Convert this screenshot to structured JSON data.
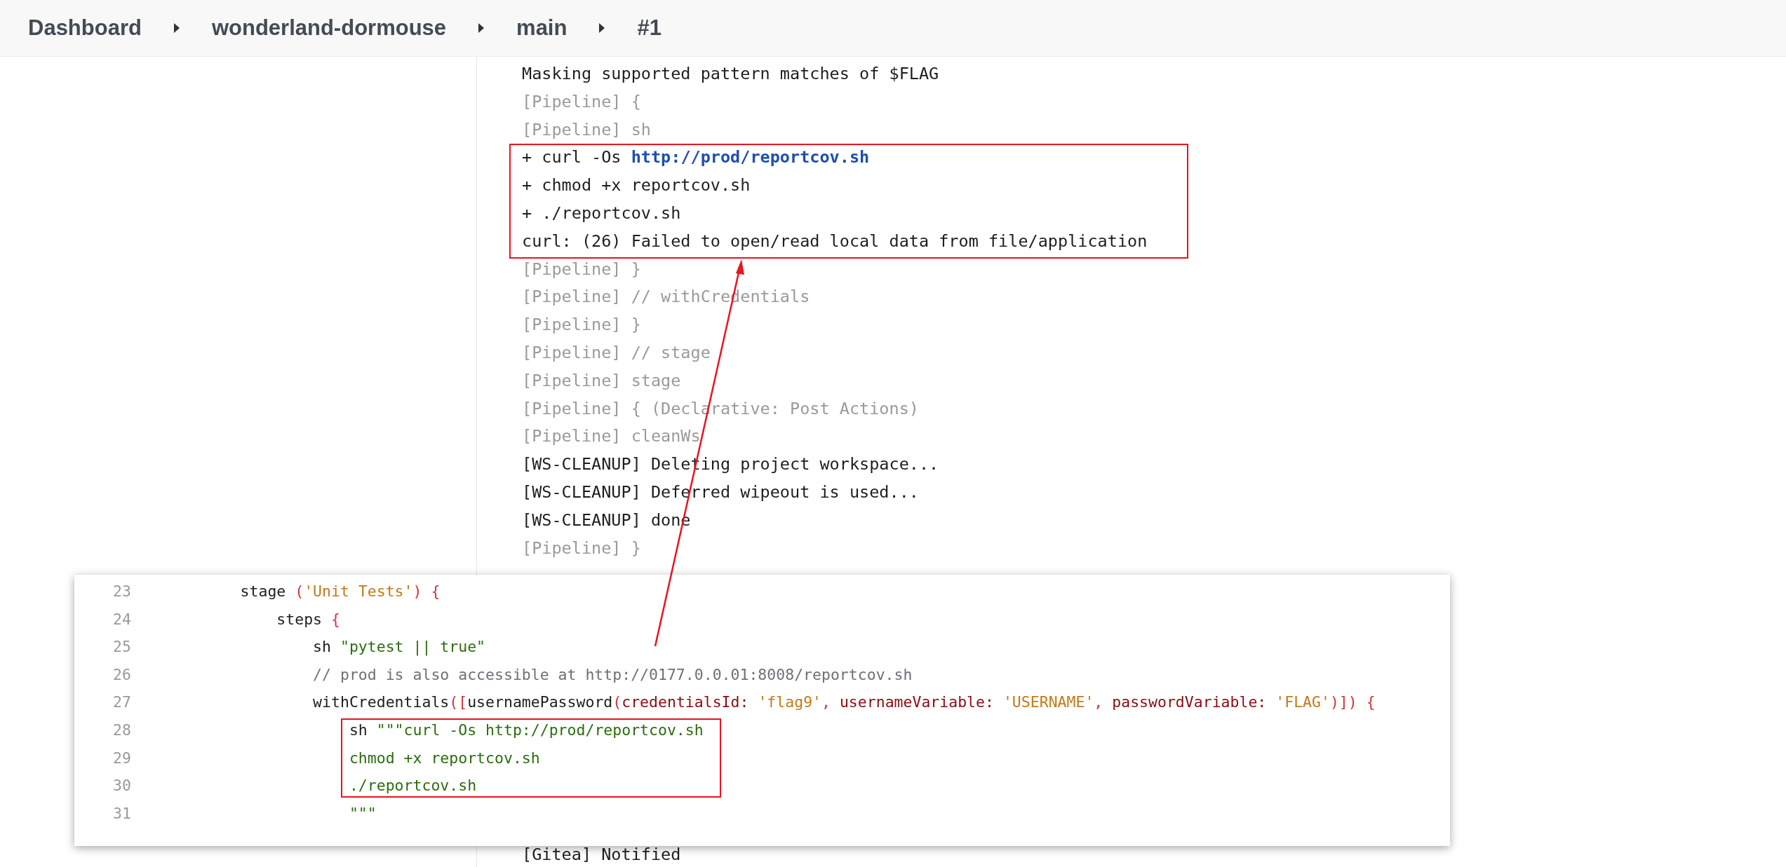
{
  "breadcrumb": [
    {
      "label": "Dashboard"
    },
    {
      "label": "wonderland-dormouse"
    },
    {
      "label": "main"
    },
    {
      "label": "#1"
    }
  ],
  "console": {
    "lines": [
      {
        "kind": "output",
        "text": "Masking supported pattern matches of $FLAG"
      },
      {
        "kind": "pipeline",
        "text": "[Pipeline] {"
      },
      {
        "kind": "pipeline",
        "text": "[Pipeline] sh"
      },
      {
        "kind": "output",
        "text": "+ curl -Os ",
        "link": "http://prod/reportcov.sh"
      },
      {
        "kind": "output",
        "text": "+ chmod +x reportcov.sh"
      },
      {
        "kind": "output",
        "text": "+ ./reportcov.sh"
      },
      {
        "kind": "output",
        "text": "curl: (26) Failed to open/read local data from file/application"
      },
      {
        "kind": "pipeline",
        "text": "[Pipeline] }"
      },
      {
        "kind": "pipeline",
        "text": "[Pipeline] // withCredentials"
      },
      {
        "kind": "pipeline",
        "text": "[Pipeline] }"
      },
      {
        "kind": "pipeline",
        "text": "[Pipeline] // stage"
      },
      {
        "kind": "pipeline",
        "text": "[Pipeline] stage"
      },
      {
        "kind": "pipeline",
        "text": "[Pipeline] { (Declarative: Post Actions)"
      },
      {
        "kind": "pipeline",
        "text": "[Pipeline] cleanWs"
      },
      {
        "kind": "output",
        "text": "[WS-CLEANUP] Deleting project workspace..."
      },
      {
        "kind": "output",
        "text": "[WS-CLEANUP] Deferred wipeout is used..."
      },
      {
        "kind": "output",
        "text": "[WS-CLEANUP] done"
      },
      {
        "kind": "pipeline",
        "text": "[Pipeline] }"
      }
    ],
    "after_overlay": [
      {
        "kind": "output",
        "text": "[Gitea] Notified"
      }
    ]
  },
  "code_snippet": {
    "lines": [
      {
        "number": "23",
        "tokens": [
          {
            "kind": "plain",
            "text": "        stage "
          },
          {
            "kind": "punct",
            "text": "("
          },
          {
            "kind": "string",
            "text": "'Unit Tests'"
          },
          {
            "kind": "punct",
            "text": ") {"
          }
        ]
      },
      {
        "number": "24",
        "tokens": [
          {
            "kind": "plain",
            "text": "            steps "
          },
          {
            "kind": "punct",
            "text": "{"
          }
        ]
      },
      {
        "number": "25",
        "tokens": [
          {
            "kind": "plain",
            "text": "                sh "
          },
          {
            "kind": "shstring",
            "text": "\"pytest || true\""
          }
        ]
      },
      {
        "number": "26",
        "tokens": [
          {
            "kind": "comment",
            "text": "                // prod is also accessible at http://0177.0.0.01:8008/reportcov.sh"
          }
        ]
      },
      {
        "number": "27",
        "tokens": [
          {
            "kind": "plain",
            "text": "                withCredentials"
          },
          {
            "kind": "punct",
            "text": "(["
          },
          {
            "kind": "plain",
            "text": "usernamePassword"
          },
          {
            "kind": "punct",
            "text": "("
          },
          {
            "kind": "key",
            "text": "credentialsId: "
          },
          {
            "kind": "string",
            "text": "'flag9'"
          },
          {
            "kind": "punct",
            "text": ", "
          },
          {
            "kind": "key",
            "text": "usernameVariable: "
          },
          {
            "kind": "string",
            "text": "'USERNAME'"
          },
          {
            "kind": "punct",
            "text": ", "
          },
          {
            "kind": "key",
            "text": "passwordVariable: "
          },
          {
            "kind": "string",
            "text": "'FLAG'"
          },
          {
            "kind": "punct",
            "text": ")]) {"
          }
        ]
      },
      {
        "number": "28",
        "tokens": [
          {
            "kind": "plain",
            "text": "                    sh "
          },
          {
            "kind": "shstring",
            "text": "\"\"\"curl -Os http://prod/reportcov.sh"
          }
        ]
      },
      {
        "number": "29",
        "tokens": [
          {
            "kind": "shstring",
            "text": "                    chmod +x reportcov.sh"
          }
        ]
      },
      {
        "number": "30",
        "tokens": [
          {
            "kind": "shstring",
            "text": "                    ./reportcov.sh"
          }
        ]
      },
      {
        "number": "31",
        "tokens": [
          {
            "kind": "shstring",
            "text": "                    \"\"\""
          }
        ]
      }
    ]
  }
}
